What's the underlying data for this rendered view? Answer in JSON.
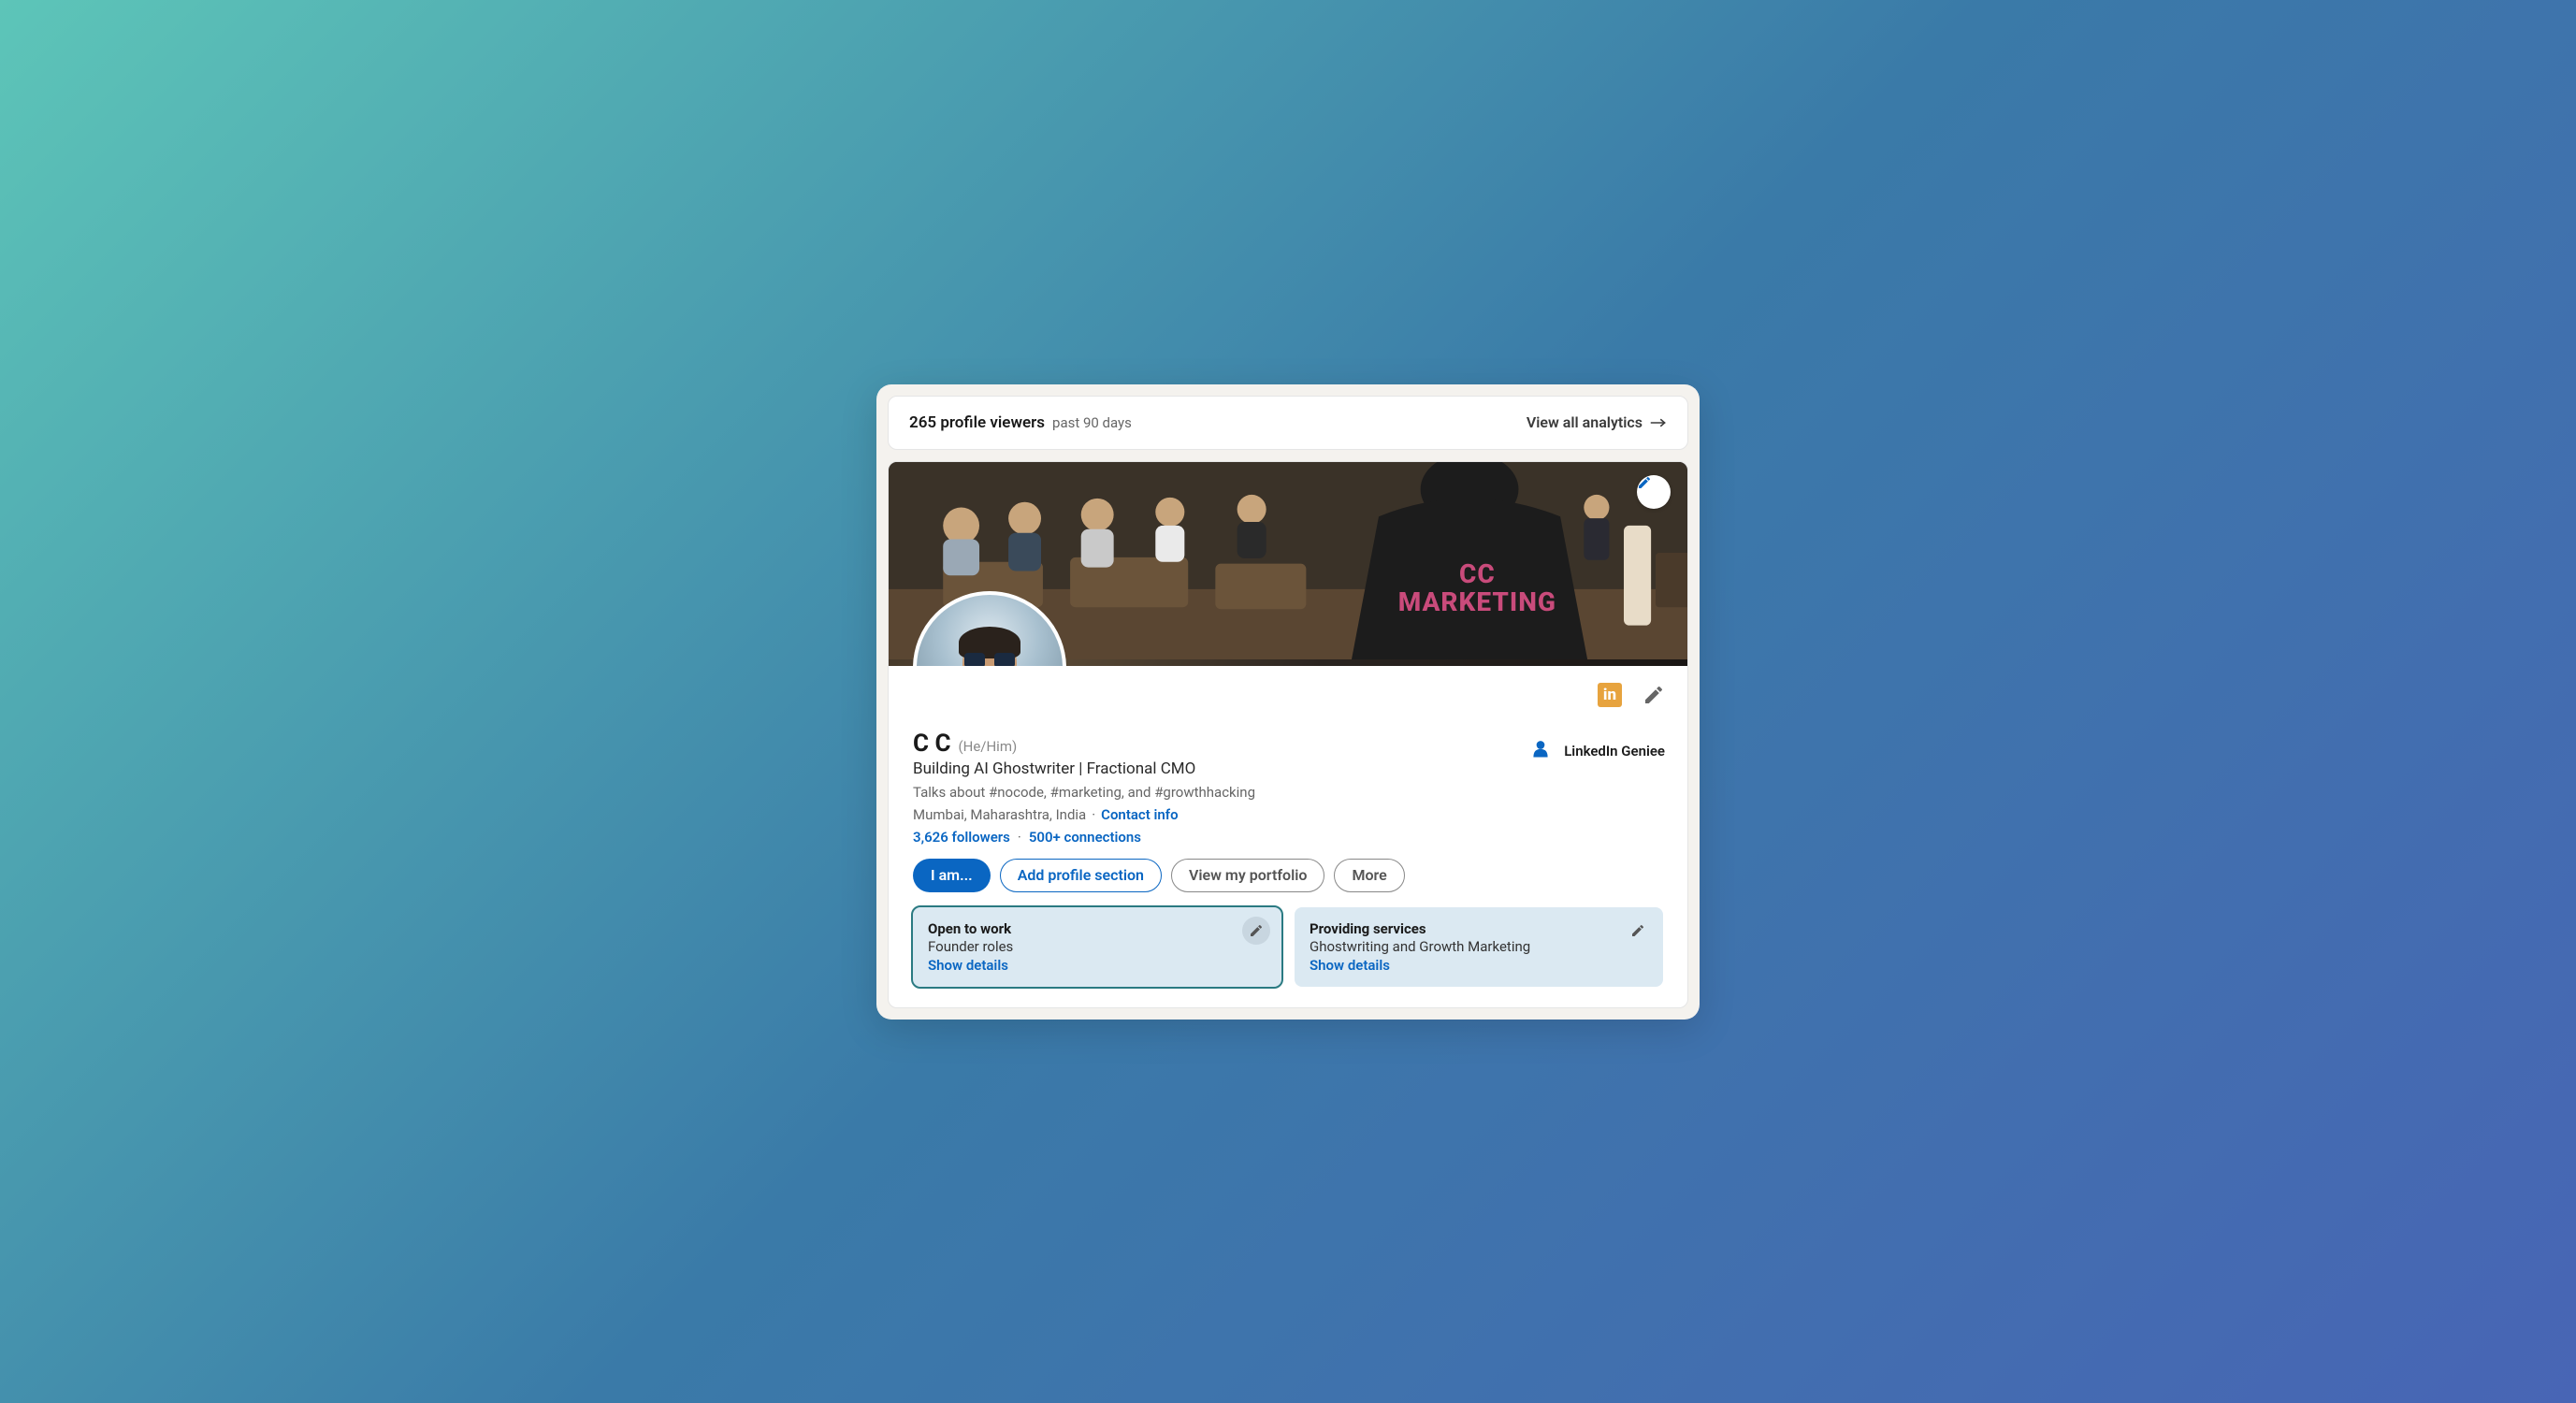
{
  "analytics": {
    "count_label": "265 profile viewers",
    "period_label": "past 90 days",
    "view_all_label": "View all analytics"
  },
  "cover": {
    "shirt_line1": "CC",
    "shirt_line2": "MARKETING"
  },
  "profile": {
    "name": "C C",
    "pronouns": "(He/Him)",
    "headline": "Building AI Ghostwriter | Fractional CMO",
    "hashtags": "Talks about #nocode, #marketing, and #growthhacking",
    "location": "Mumbai, Maharashtra, India",
    "contact_label": "Contact info",
    "followers_label": "3,626 followers",
    "connections_label": "500+ connections",
    "linkedin_badge": "in"
  },
  "org": {
    "name": "LinkedIn Geniee"
  },
  "buttons": {
    "primary": "I am...",
    "add_section": "Add profile section",
    "portfolio": "View my portfolio",
    "more": "More"
  },
  "open_to_work": {
    "title": "Open to work",
    "sub": "Founder roles",
    "link": "Show details"
  },
  "providing_services": {
    "title": "Providing services",
    "sub": "Ghostwriting and Growth Marketing",
    "link": "Show details"
  }
}
